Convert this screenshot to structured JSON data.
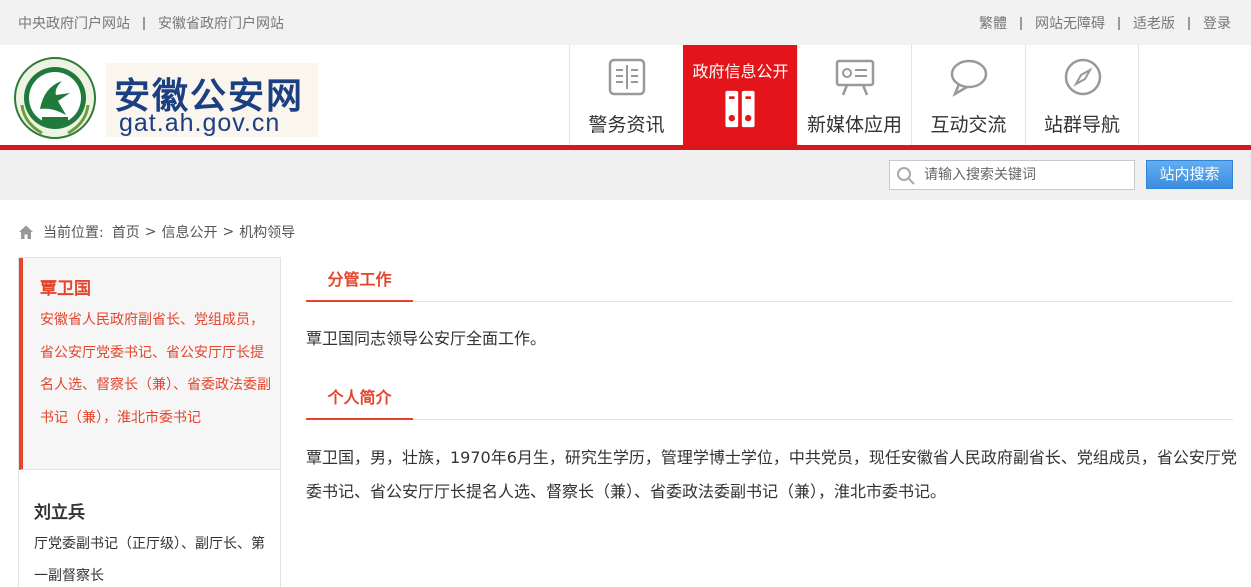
{
  "topbar": {
    "left_links": [
      "中央政府门户网站",
      "安徽省政府门户网站"
    ],
    "right_links": [
      "繁體",
      "网站无障碍",
      "适老版",
      "登录"
    ]
  },
  "logo": {
    "name": "安徽公安网",
    "url": "gat.ah.gov.cn"
  },
  "nav": {
    "items": [
      {
        "label": "警务资讯",
        "icon": "document-icon"
      },
      {
        "label": "政府信息公开",
        "icon": "binders-icon",
        "active": true
      },
      {
        "label": "新媒体应用",
        "icon": "presentation-board-icon"
      },
      {
        "label": "互动交流",
        "icon": "chat-bubble-icon"
      },
      {
        "label": "站群导航",
        "icon": "compass-icon"
      }
    ]
  },
  "search": {
    "placeholder": "请输入搜索关键词",
    "button_label": "站内搜索"
  },
  "breadcrumb": {
    "prefix": "当前位置:",
    "items": [
      "首页",
      "信息公开",
      "机构领导"
    ]
  },
  "sidebar": {
    "people": [
      {
        "name": "覃卫国",
        "title": "安徽省人民政府副省长、党组成员，省公安厅党委书记、省公安厅厅长提名人选、督察长（兼）、省委政法委副书记（兼），淮北市委书记"
      },
      {
        "name": "刘立兵",
        "title": "厅党委副书记（正厅级）、副厅长、第一副督察长"
      }
    ]
  },
  "main": {
    "sections": [
      {
        "tab": "分管工作",
        "text": "覃卫国同志领导公安厅全面工作。"
      },
      {
        "tab": "个人简介",
        "text": "覃卫国，男，壮族，1970年6月生，研究生学历，管理学博士学位，中共党员，现任安徽省人民政府副省长、党组成员，省公安厅党委书记、省公安厅厅长提名人选、督察长（兼）、省委政法委副书记（兼），淮北市委书记。"
      }
    ]
  },
  "colors": {
    "accent_red": "#e4151a",
    "section_orange": "#e4452d",
    "logo_blue": "#1c3f83",
    "search_blue": "#3a8ee0"
  }
}
